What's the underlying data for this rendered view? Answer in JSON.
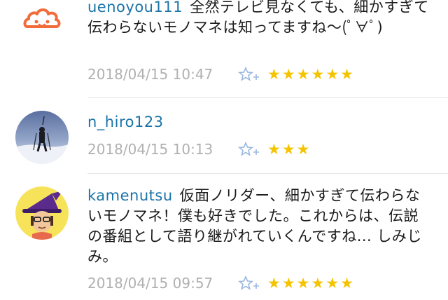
{
  "comments": [
    {
      "username": "uenoyou111",
      "text": "全然テレビ見なくても、細かすぎて伝わらないモノマネは知ってますね〜(ﾟ∀ﾟ)",
      "timestamp": "2018/04/15 10:47",
      "stars": 6
    },
    {
      "username": "n_hiro123",
      "text": "",
      "timestamp": "2018/04/15 10:13",
      "stars": 3
    },
    {
      "username": "kamenutsu",
      "text": "仮面ノリダー、細かすぎて伝わらないモノマネ！僕も好きでした。これからは、伝説の番組として語り継がれていくんですね... しみじみ。",
      "timestamp": "2018/04/15 09:57",
      "stars": 6
    }
  ],
  "icons": {
    "add_star": "star-plus-icon",
    "star": "filled-star-icon"
  },
  "colors": {
    "username": "#1a73a8",
    "timestamp": "#b0b0b0",
    "star": "#f5c400",
    "add_star": "#9bb7e0",
    "avatar1": "#f26b3a"
  }
}
